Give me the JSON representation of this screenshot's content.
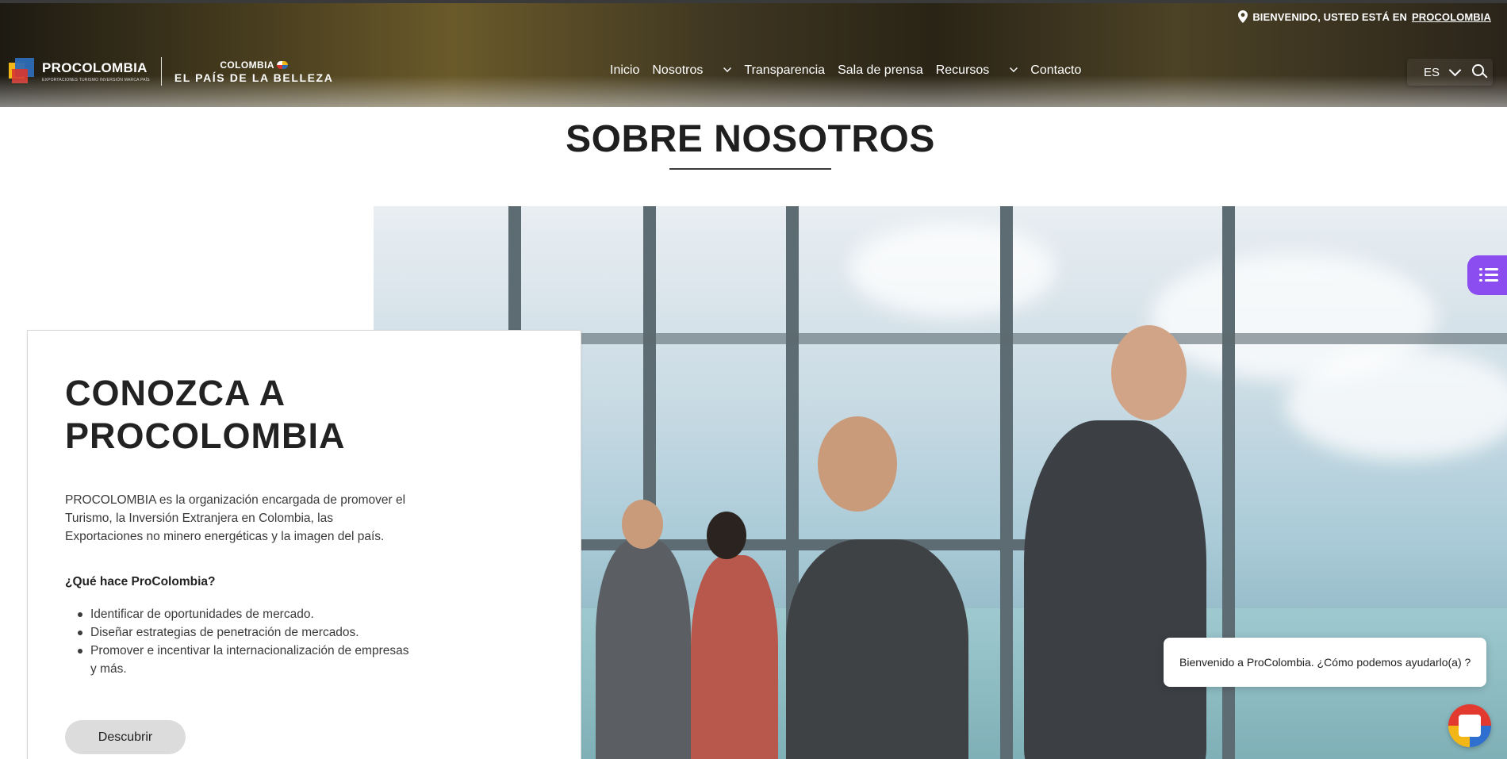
{
  "header": {
    "welcome_prefix": "BIENVENIDO, USTED ESTÁ EN",
    "welcome_link": "PROCOLOMBIA",
    "logo_name": "PROCOLOMBIA",
    "logo_tagline": "EXPORTACIONES TURISMO INVERSIÓN MARCA PAÍS",
    "country_line1": "COLOMBIA",
    "country_line2": "EL PAÍS DE LA BELLEZA",
    "nav": {
      "inicio": "Inicio",
      "nosotros": "Nosotros",
      "transparencia": "Transparencia",
      "sala_prensa": "Sala de prensa",
      "recursos": "Recursos",
      "contacto": "Contacto"
    },
    "language": "ES"
  },
  "main": {
    "section_title": "SOBRE NOSOTROS",
    "card": {
      "title": "CONOZCA A PROCOLOMBIA",
      "description": "PROCOLOMBIA es la organización encargada de promover el Turismo, la Inversión Extranjera en Colombia, las Exportaciones no minero energéticas y la imagen del país.",
      "question": "¿Qué hace ProColombia?",
      "items": [
        "Identificar de oportunidades de mercado.",
        "Diseñar estrategias de penetración de mercados.",
        "Promover e incentivar la internacionalización de empresas y más."
      ],
      "button": "Descubrir"
    }
  },
  "chat": {
    "greeting": "Bienvenido a ProColombia. ¿Cómo podemos ayudarlo(a) ?"
  },
  "colors": {
    "side_tab": "#8b4cf0",
    "button_bg": "#dcdcdc"
  }
}
